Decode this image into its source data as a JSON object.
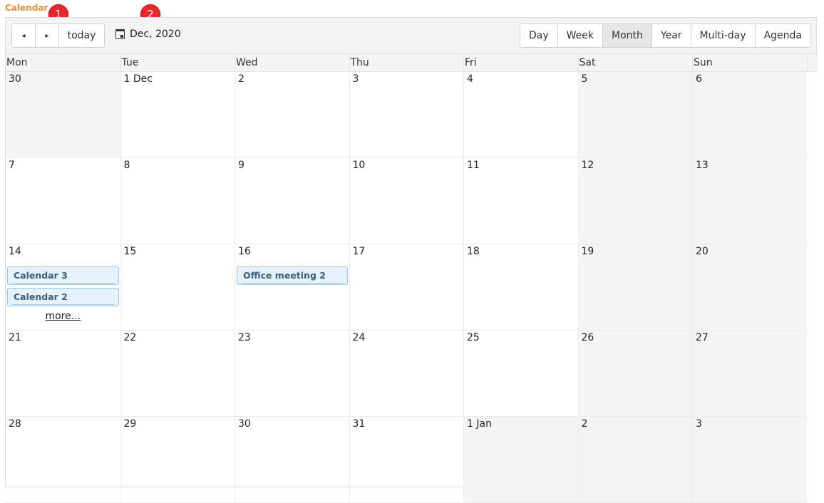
{
  "app": {
    "title": "Calendar"
  },
  "markers": [
    "1",
    "2"
  ],
  "toolbar": {
    "prev_icon": "◂",
    "next_icon": "▸",
    "today_label": "today",
    "date_label": "Dec, 2020",
    "views": [
      "Day",
      "Week",
      "Month",
      "Year",
      "Multi-day",
      "Agenda"
    ],
    "active_view": "Month"
  },
  "weekdays": [
    "Mon",
    "Tue",
    "Wed",
    "Thu",
    "Fri",
    "Sat",
    "Sun"
  ],
  "weeks": [
    {
      "days": [
        {
          "label": "30",
          "shaded": true
        },
        {
          "label": "1 Dec",
          "shaded": false
        },
        {
          "label": "2",
          "shaded": false
        },
        {
          "label": "3",
          "shaded": false
        },
        {
          "label": "4",
          "shaded": false
        },
        {
          "label": "5",
          "shaded": true
        },
        {
          "label": "6",
          "shaded": true
        }
      ]
    },
    {
      "days": [
        {
          "label": "7",
          "shaded": false
        },
        {
          "label": "8",
          "shaded": false
        },
        {
          "label": "9",
          "shaded": false
        },
        {
          "label": "10",
          "shaded": false
        },
        {
          "label": "11",
          "shaded": false
        },
        {
          "label": "12",
          "shaded": true
        },
        {
          "label": "13",
          "shaded": true
        }
      ]
    },
    {
      "days": [
        {
          "label": "14",
          "shaded": false,
          "events": [
            "Calendar 3",
            "Calendar 2"
          ],
          "more": "more..."
        },
        {
          "label": "15",
          "shaded": false
        },
        {
          "label": "16",
          "shaded": false,
          "events": [
            "Office meeting 2"
          ]
        },
        {
          "label": "17",
          "shaded": false
        },
        {
          "label": "18",
          "shaded": false
        },
        {
          "label": "19",
          "shaded": true
        },
        {
          "label": "20",
          "shaded": true
        }
      ]
    },
    {
      "days": [
        {
          "label": "21",
          "shaded": false
        },
        {
          "label": "22",
          "shaded": false
        },
        {
          "label": "23",
          "shaded": false
        },
        {
          "label": "24",
          "shaded": false
        },
        {
          "label": "25",
          "shaded": false
        },
        {
          "label": "26",
          "shaded": true
        },
        {
          "label": "27",
          "shaded": true
        }
      ]
    },
    {
      "days": [
        {
          "label": "28",
          "shaded": false
        },
        {
          "label": "29",
          "shaded": false
        },
        {
          "label": "30",
          "shaded": false
        },
        {
          "label": "31",
          "shaded": false
        },
        {
          "label": "1 Jan",
          "shaded": true
        },
        {
          "label": "2",
          "shaded": true
        },
        {
          "label": "3",
          "shaded": true
        }
      ]
    }
  ],
  "colors": {
    "title": "#e8903a",
    "event_bg": "#e5f2fb",
    "event_border": "#9cc4df",
    "event_text": "#3a5f82",
    "shaded_day": "#f4f4f4",
    "marker": "#e8262b"
  }
}
